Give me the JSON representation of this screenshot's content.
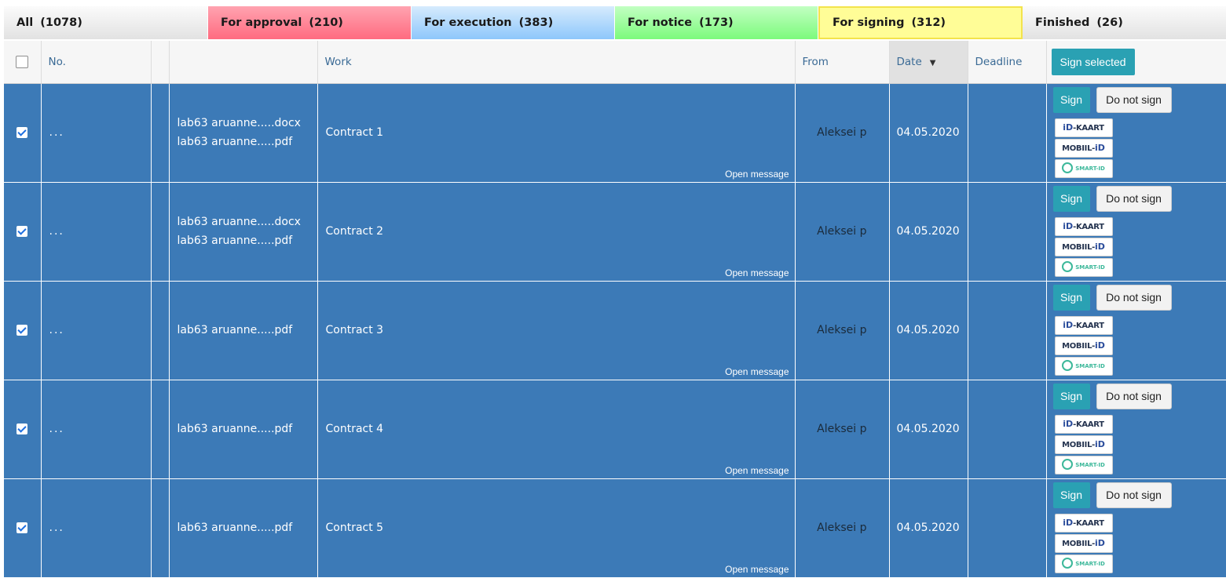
{
  "tabs": [
    {
      "label": "All",
      "count": "(1078)"
    },
    {
      "label": "For approval",
      "count": "(210)"
    },
    {
      "label": "For execution",
      "count": "(383)"
    },
    {
      "label": "For notice",
      "count": "(173)"
    },
    {
      "label": "For signing",
      "count": "(312)"
    },
    {
      "label": "Finished",
      "count": "(26)"
    }
  ],
  "active_tab": "For signing",
  "header": {
    "no": "No.",
    "work": "Work",
    "from": "From",
    "date": "Date",
    "date_sort": "▼",
    "deadline": "Deadline",
    "sign_selected": "Sign selected"
  },
  "actions": {
    "sign": "Sign",
    "do_not_sign": "Do not sign",
    "open_message": "Open message",
    "idkaart_mark": "iD",
    "idkaart_text": "-KAART",
    "mobiil_text": "MOBIIL-",
    "mobiil_mark": "iD",
    "smartid_text": "SMART-ID"
  },
  "rows": [
    {
      "no": "...",
      "files": [
        "lab63 aruanne.....docx",
        "lab63 aruanne.....pdf"
      ],
      "work": "Contract 1",
      "from": "Aleksei p",
      "date": "04.05.2020",
      "deadline": "",
      "checked": true
    },
    {
      "no": "...",
      "files": [
        "lab63 aruanne.....docx",
        "lab63 aruanne.....pdf"
      ],
      "work": "Contract 2",
      "from": "Aleksei p",
      "date": "04.05.2020",
      "deadline": "",
      "checked": true
    },
    {
      "no": "...",
      "files": [
        "lab63 aruanne.....pdf"
      ],
      "work": "Contract 3",
      "from": "Aleksei p",
      "date": "04.05.2020",
      "deadline": "",
      "checked": true
    },
    {
      "no": "...",
      "files": [
        "lab63 aruanne.....pdf"
      ],
      "work": "Contract 4",
      "from": "Aleksei p",
      "date": "04.05.2020",
      "deadline": "",
      "checked": true
    },
    {
      "no": "...",
      "files": [
        "lab63 aruanne.....pdf"
      ],
      "work": "Contract 5",
      "from": "Aleksei p",
      "date": "04.05.2020",
      "deadline": "",
      "checked": true
    }
  ],
  "colors": {
    "row_selected": "#3c7ab7",
    "button_teal": "#2aa1b3",
    "tab_approval": "#ff6b80",
    "tab_execution": "#8ec7fb",
    "tab_notice": "#7cfa7c",
    "tab_signing": "#fffd97"
  }
}
